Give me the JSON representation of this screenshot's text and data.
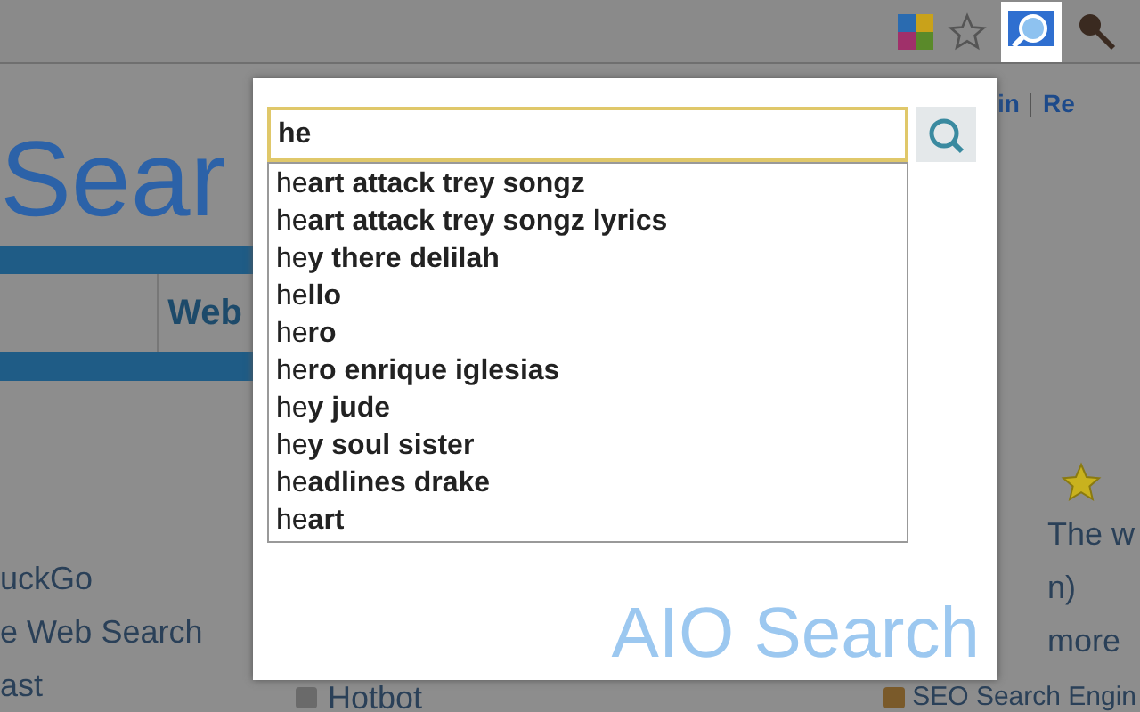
{
  "toolbar": {
    "extension_active": true
  },
  "page": {
    "logo": "Sear",
    "tab": "Web",
    "header_links": [
      "in",
      "Re"
    ],
    "left_links": [
      "uckGo",
      "e Web Search",
      "ast"
    ],
    "bottom_link": "Hotbot",
    "right_texts": [
      "The w",
      "n)",
      "more"
    ],
    "right_bottom_link": "SEO Search Engin"
  },
  "popup": {
    "query": "he",
    "suggestions": [
      "he**art attack trey songz**",
      "he**art attack trey songz lyrics**",
      "he**y there delilah**",
      "he**llo**",
      "he**ro**",
      "he**ro enrique iglesias**",
      "he**y jude**",
      "he**y soul sister**",
      "he**adlines drake**",
      "he**art**"
    ],
    "logo": "AIO Search"
  }
}
